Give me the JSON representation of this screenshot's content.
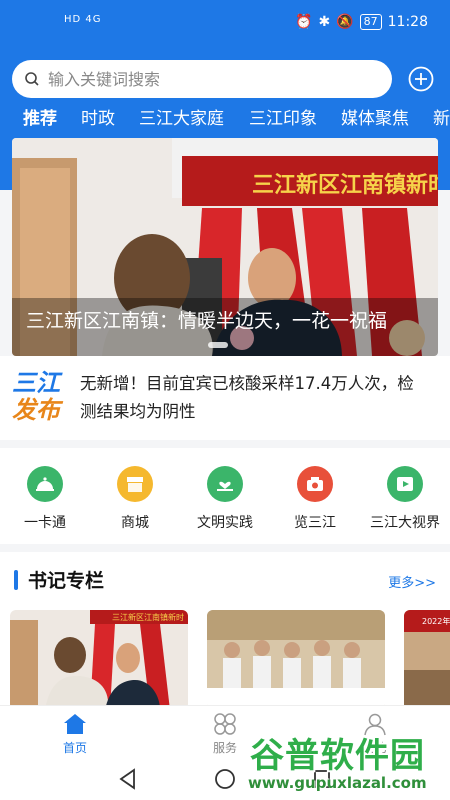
{
  "status_bar": {
    "network": "HD 4G",
    "battery": "87",
    "time": "11:28"
  },
  "search": {
    "placeholder": "输入关键词搜索"
  },
  "tabs": [
    {
      "label": "推荐",
      "active": true
    },
    {
      "label": "时政"
    },
    {
      "label": "三江大家庭"
    },
    {
      "label": "三江印象"
    },
    {
      "label": "媒体聚焦"
    },
    {
      "label": "新"
    }
  ],
  "banner": {
    "caption": "三江新区江南镇：情暖半边天，一花一祝福",
    "sign_text": "三江新区江南镇新时"
  },
  "news": {
    "logo_line1": "三江",
    "logo_line2": "发布",
    "text": "无新增！目前宜宾已核酸采样17.4万人次，检测结果均为阴性"
  },
  "quick_links": [
    {
      "label": "一卡通",
      "icon": "cloche-icon",
      "color": "#3bb56a"
    },
    {
      "label": "商城",
      "icon": "shop-icon",
      "color": "#f5b82e"
    },
    {
      "label": "文明实践",
      "icon": "heart-hand-icon",
      "color": "#3bb56a"
    },
    {
      "label": "览三江",
      "icon": "camera-icon",
      "color": "#e8503a"
    },
    {
      "label": "三江大视界",
      "icon": "film-icon",
      "color": "#3bb56a"
    }
  ],
  "column": {
    "title": "书记专栏",
    "more": "更多>>",
    "thumb1_sign": "三江新区江南镇新时",
    "thumb3_sign": "2022年"
  },
  "bottom_nav": [
    {
      "label": "首页",
      "active": true
    },
    {
      "label": "服务"
    },
    {
      "label": "我的"
    }
  ],
  "watermark": {
    "title": "谷普软件园",
    "url": "www.gupuxlazal.com"
  },
  "colors": {
    "brand": "#1e78e6"
  }
}
